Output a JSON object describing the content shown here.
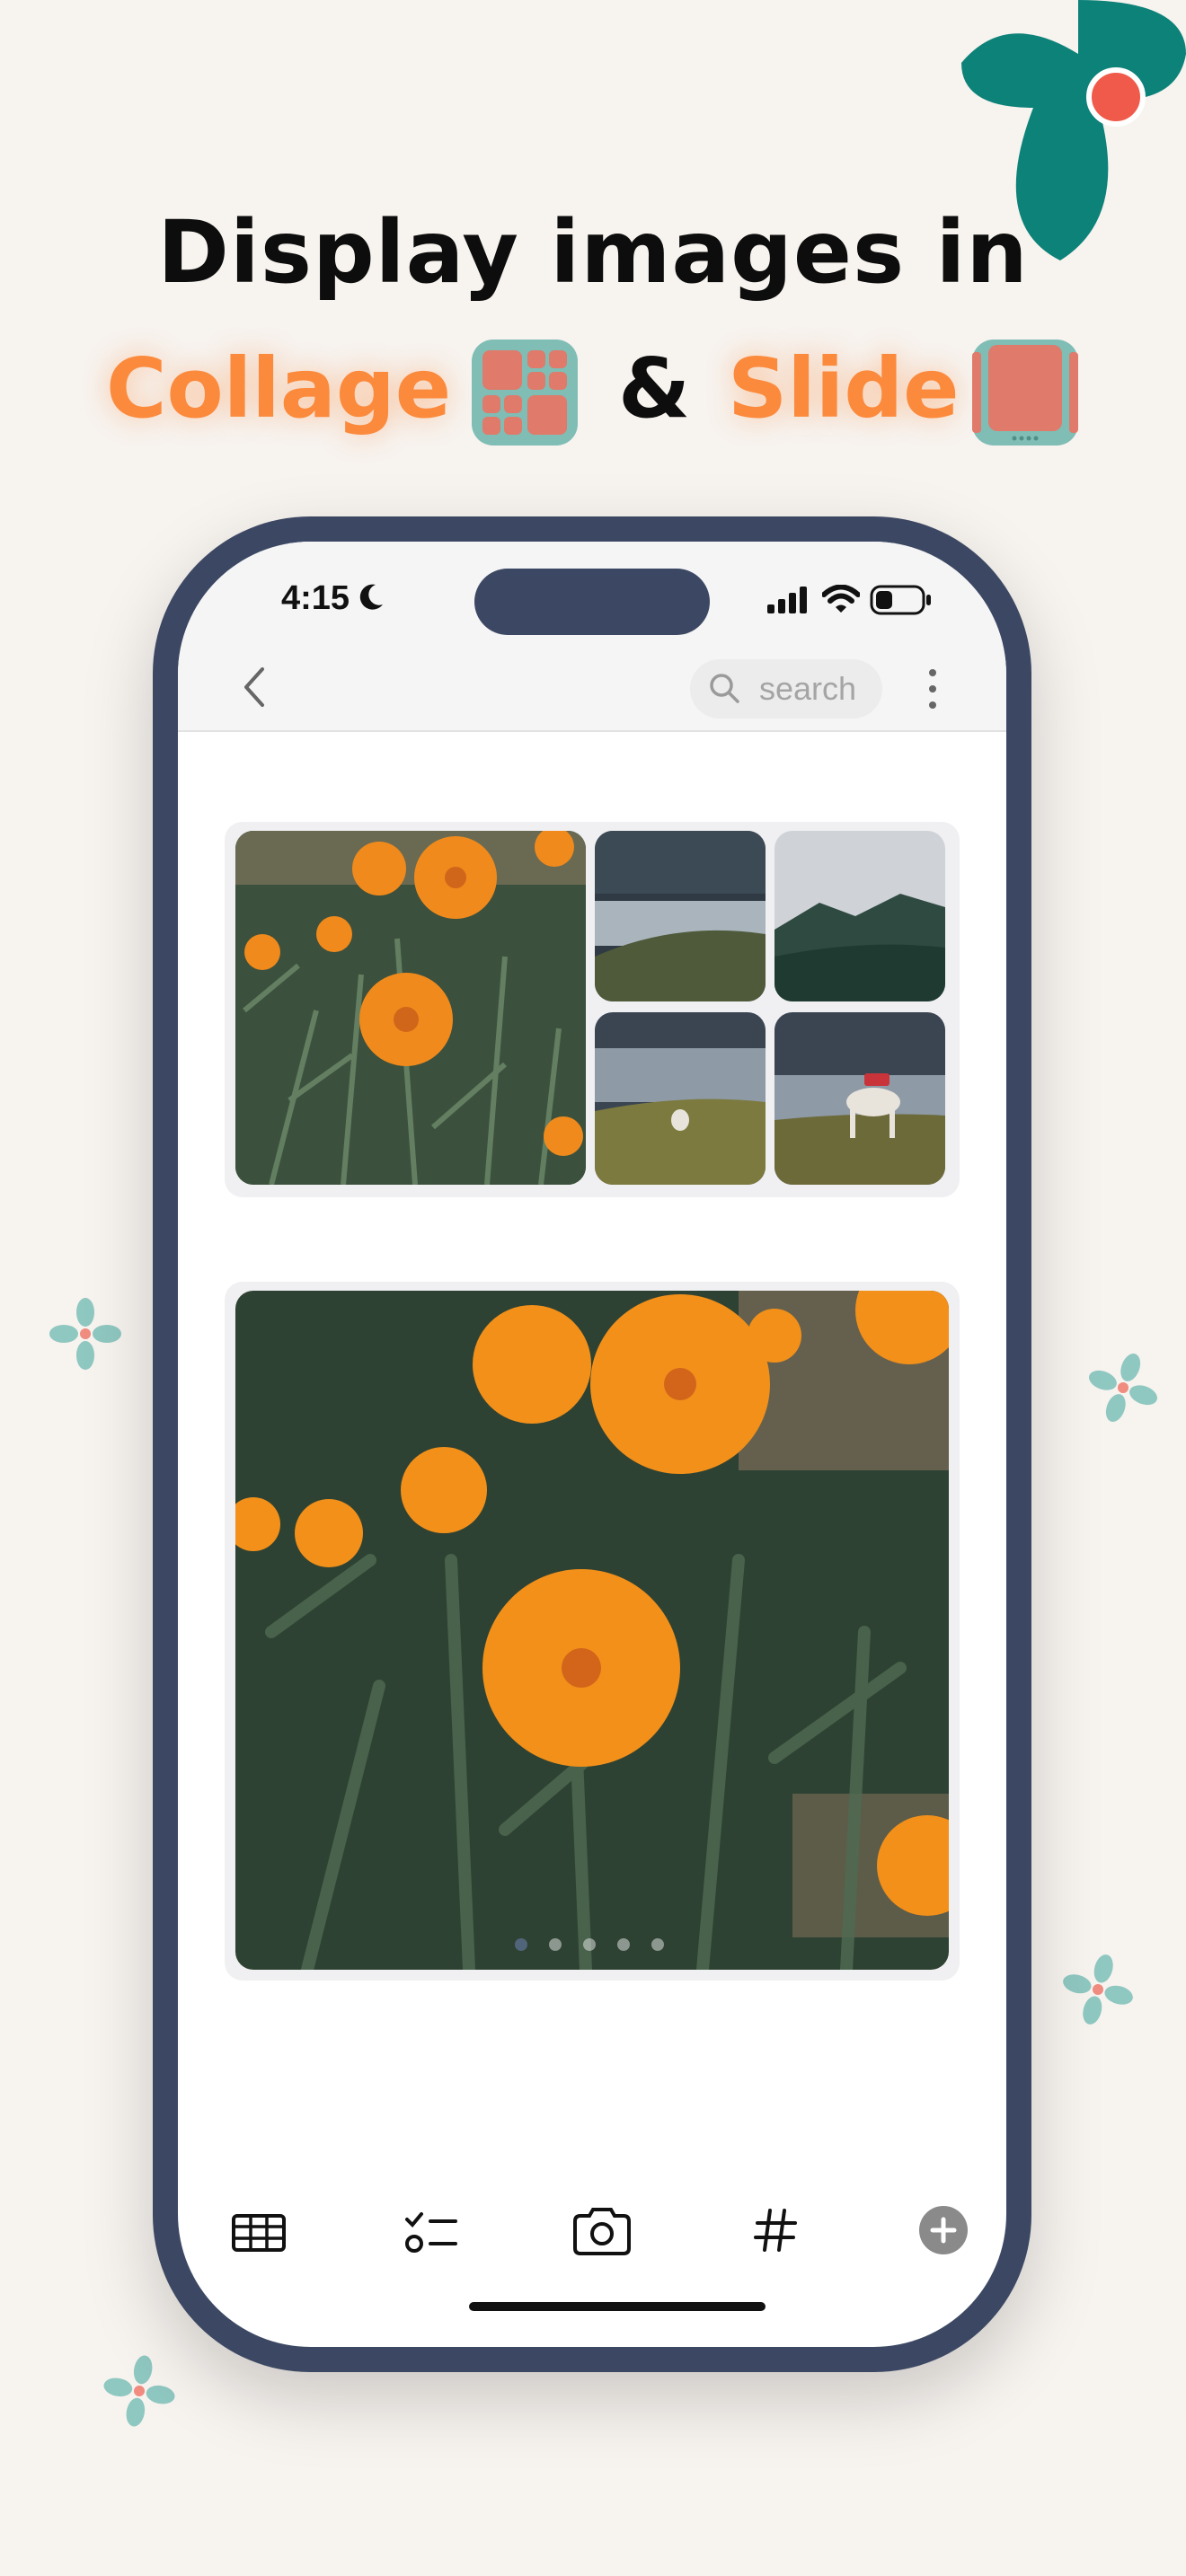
{
  "headline": {
    "line1": "Display images in",
    "word_collage": "Collage",
    "word_and": "&",
    "word_slide": "Slide"
  },
  "colors": {
    "background": "#f7f3ef",
    "accent_orange": "#fb8a3c",
    "phone_frame": "#3c4863",
    "teal": "#0d8279",
    "icon_tile_bg": "#7fbdb5",
    "icon_tile_fg": "#e07a6a"
  },
  "status_bar": {
    "time": "4:15",
    "icons": [
      "moon-icon",
      "cellular-signal-icon",
      "wifi-icon",
      "battery-icon"
    ]
  },
  "nav": {
    "back_icon": "chevron-left-icon",
    "search_placeholder": "search",
    "more_icon": "more-vertical-icon"
  },
  "collage": {
    "images": [
      "marigold-flowers",
      "lake-shore",
      "mountain-valley",
      "lake-with-bird",
      "white-horse-by-lake"
    ]
  },
  "slide": {
    "image": "marigold-flowers-closeup",
    "page_count": 5,
    "current_page": 1
  },
  "tab_bar": {
    "items": [
      "table-icon",
      "checklist-icon",
      "camera-icon",
      "hashtag-icon",
      "add-circle-icon"
    ]
  }
}
